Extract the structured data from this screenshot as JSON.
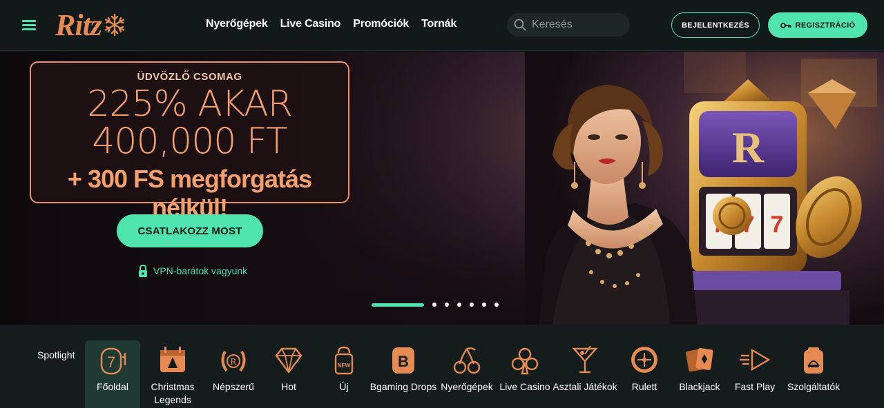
{
  "header": {
    "logo_text": "Ritz",
    "nav": [
      "Nyerőgépek",
      "Live Casino",
      "Promóciók",
      "Tornák"
    ],
    "search_placeholder": "Keresés",
    "login_label": "BEJELENTKEZÉS",
    "register_label": "REGISZTRÁCIÓ"
  },
  "hero": {
    "kicker": "ÜDVÖZLŐ CSOMAG",
    "line1": "225% AKAR",
    "line2": "400,000 FT",
    "line3": "+ 300 FS megforgatás nélkül!",
    "cta_label": "CSATLAKOZZ MOST",
    "vpn_text": "VPN-barátok vagyunk",
    "slide_count": 7,
    "active_slide": 1
  },
  "categories": {
    "spotlight_label": "Spotlight",
    "items": [
      {
        "label": "Főoldal",
        "icon": "slot-seven-icon",
        "active": true
      },
      {
        "label": "Christmas Legends",
        "icon": "christmas-calendar-icon",
        "active": false
      },
      {
        "label": "Népszerű",
        "icon": "laurel-r-icon",
        "active": false
      },
      {
        "label": "Hot",
        "icon": "diamond-icon",
        "active": false
      },
      {
        "label": "Új",
        "icon": "new-tag-icon",
        "active": false
      },
      {
        "label": "Bgaming Drops",
        "icon": "bgaming-b-icon",
        "active": false
      },
      {
        "label": "Nyerőgépek",
        "icon": "cherries-icon",
        "active": false
      },
      {
        "label": "Live Casino",
        "icon": "club-icon",
        "active": false
      },
      {
        "label": "Asztali Játékok",
        "icon": "cocktail-icon",
        "active": false
      },
      {
        "label": "Rulett",
        "icon": "roulette-icon",
        "active": false
      },
      {
        "label": "Blackjack",
        "icon": "cards-icon",
        "active": false
      },
      {
        "label": "Fast Play",
        "icon": "fast-play-icon",
        "active": false
      },
      {
        "label": "Szolgáltatók",
        "icon": "providers-icon",
        "active": false
      }
    ]
  },
  "colors": {
    "accent": "#4fe3ad",
    "promo": "#f4a06c",
    "icon": "#e48a52"
  }
}
